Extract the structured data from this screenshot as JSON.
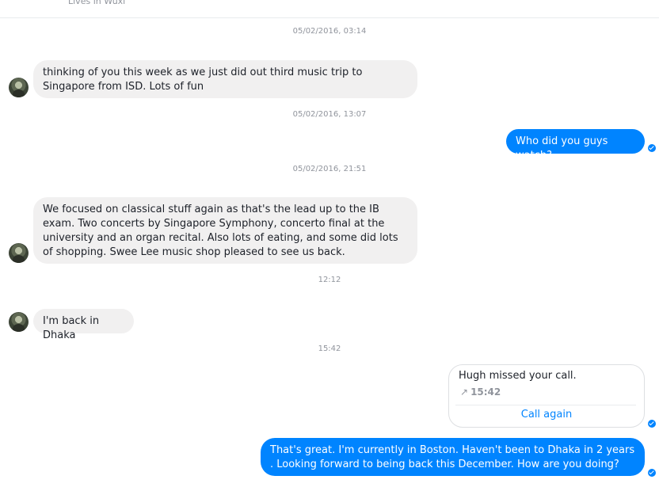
{
  "header": {
    "subtitle": "Lives in Wuxi"
  },
  "timestamps": [
    "05/02/2016, 03:14",
    "05/02/2016, 13:07",
    "05/02/2016, 21:51",
    "12:12",
    "15:42"
  ],
  "messages": [
    {
      "from": "them",
      "text": "thinking of you this week as we just did out third music trip to Singapore from ISD. Lots of fun"
    },
    {
      "from": "me",
      "text": "Who did you guys watch?"
    },
    {
      "from": "them",
      "text": "We focused on classical stuff again as that's the lead up to the IB exam. Two concerts by Singapore Symphony, concerto final at the university and an organ recital. Also lots of eating, and some did lots of shopping. Swee Lee music shop pleased to see us back."
    },
    {
      "from": "them",
      "text": "I'm back in Dhaka"
    },
    {
      "from": "me",
      "text": "That's great. I'm currently in Boston. Haven't been to Dhaka in 2 years . Looking forward to being back this December. How are you doing?"
    }
  ],
  "call": {
    "title": "Hugh missed your call.",
    "arrow": "↗",
    "time": "15:42",
    "action": "Call again"
  },
  "colors": {
    "outgoing": "#0084ff",
    "incoming": "#f1f0f0",
    "timestamp": "#90949c"
  },
  "icons": {
    "avatar": "contact-avatar",
    "read": "read-receipt-icon",
    "call_arrow": "missed-call-arrow-icon"
  }
}
